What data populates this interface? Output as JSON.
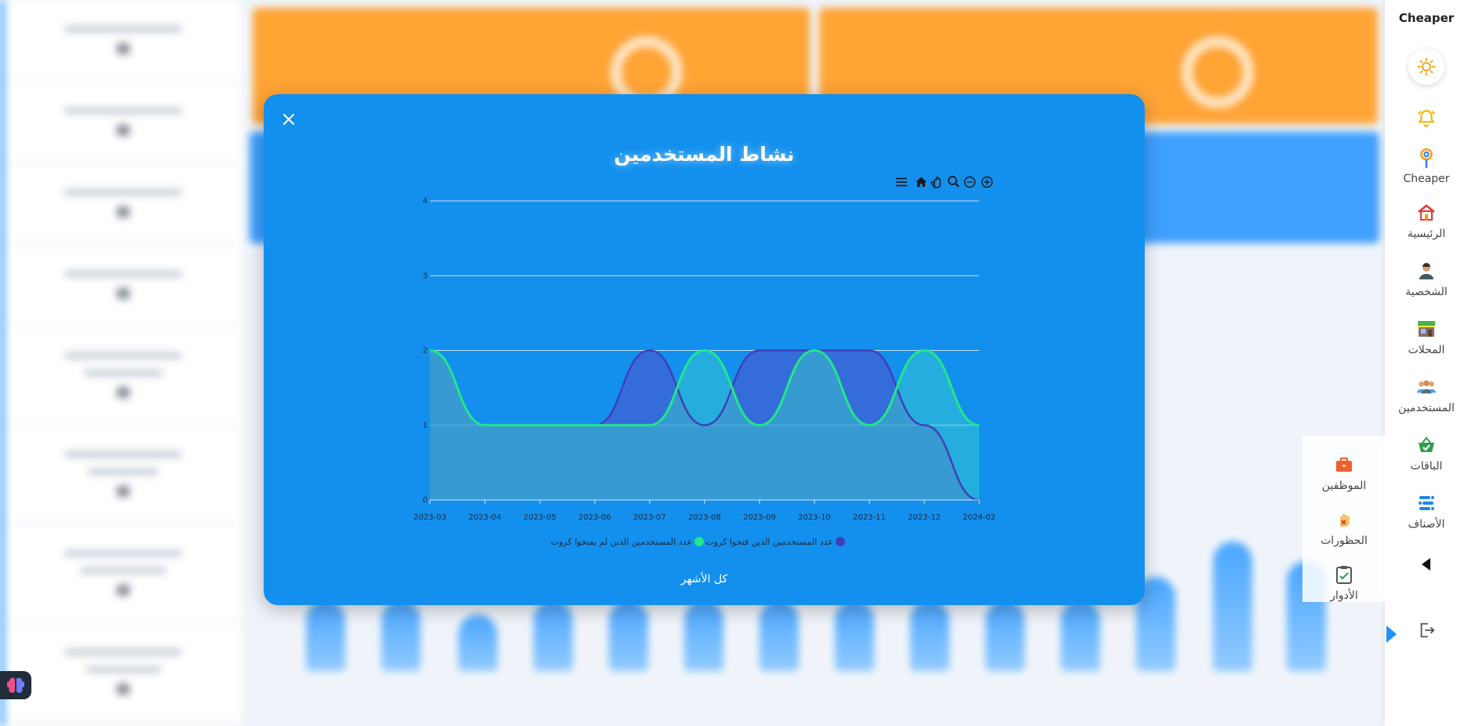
{
  "sidebar": {
    "brand": "Cheaper",
    "items": [
      {
        "label": "Cheaper",
        "icon": "map-pin-icon"
      },
      {
        "label": "الرئيسية",
        "icon": "home-icon"
      },
      {
        "label": "الشخصية",
        "icon": "user-icon"
      },
      {
        "label": "المحلات",
        "icon": "store-icon"
      },
      {
        "label": "المستخدمين",
        "icon": "users-icon"
      },
      {
        "label": "الباقات",
        "icon": "basket-icon"
      },
      {
        "label": "الأصناف",
        "icon": "categories-icon"
      }
    ],
    "floating_items": [
      {
        "label": "الموظفين",
        "icon": "briefcase-icon"
      },
      {
        "label": "الحظورات",
        "icon": "blocked-hand-icon"
      },
      {
        "label": "الأدوار",
        "icon": "clipboard-check-icon"
      }
    ]
  },
  "modal": {
    "title": "نشاط المستخدمين",
    "footer_link": "كل الأشهر"
  },
  "colors": {
    "modal_bg": "#1390ee",
    "series_opened": "#3f3fb8",
    "series_not_opened": "#22e68a",
    "accent_orange": "#ff9412"
  },
  "chart_data": {
    "type": "area",
    "title": "نشاط المستخدمين",
    "x": [
      "2023-03",
      "2023-04",
      "2023-05",
      "2023-06",
      "2023-07",
      "2023-08",
      "2023-09",
      "2023-10",
      "2023-11",
      "2023-12",
      "2024-02"
    ],
    "ylim": [
      0,
      4
    ],
    "yticks": [
      0,
      1,
      2,
      3,
      4
    ],
    "grid": true,
    "legend_position": "bottom",
    "series": [
      {
        "name": "عدد المستخدمين الذين فتحوا كروت",
        "color": "#3f3fb8",
        "values": [
          2,
          1,
          1,
          1,
          2,
          1,
          2,
          2,
          2,
          1,
          0
        ]
      },
      {
        "name": "عدد المستخدمين الذين لم يفتحوا كروت",
        "color": "#22e68a",
        "values": [
          2,
          1,
          1,
          1,
          1,
          2,
          1,
          2,
          1,
          2,
          1
        ]
      }
    ],
    "toolbar": [
      "zoom-in-icon",
      "zoom-out-icon",
      "zoom-select-icon",
      "pan-hand-icon",
      "reset-home-icon",
      "menu-icon"
    ]
  }
}
